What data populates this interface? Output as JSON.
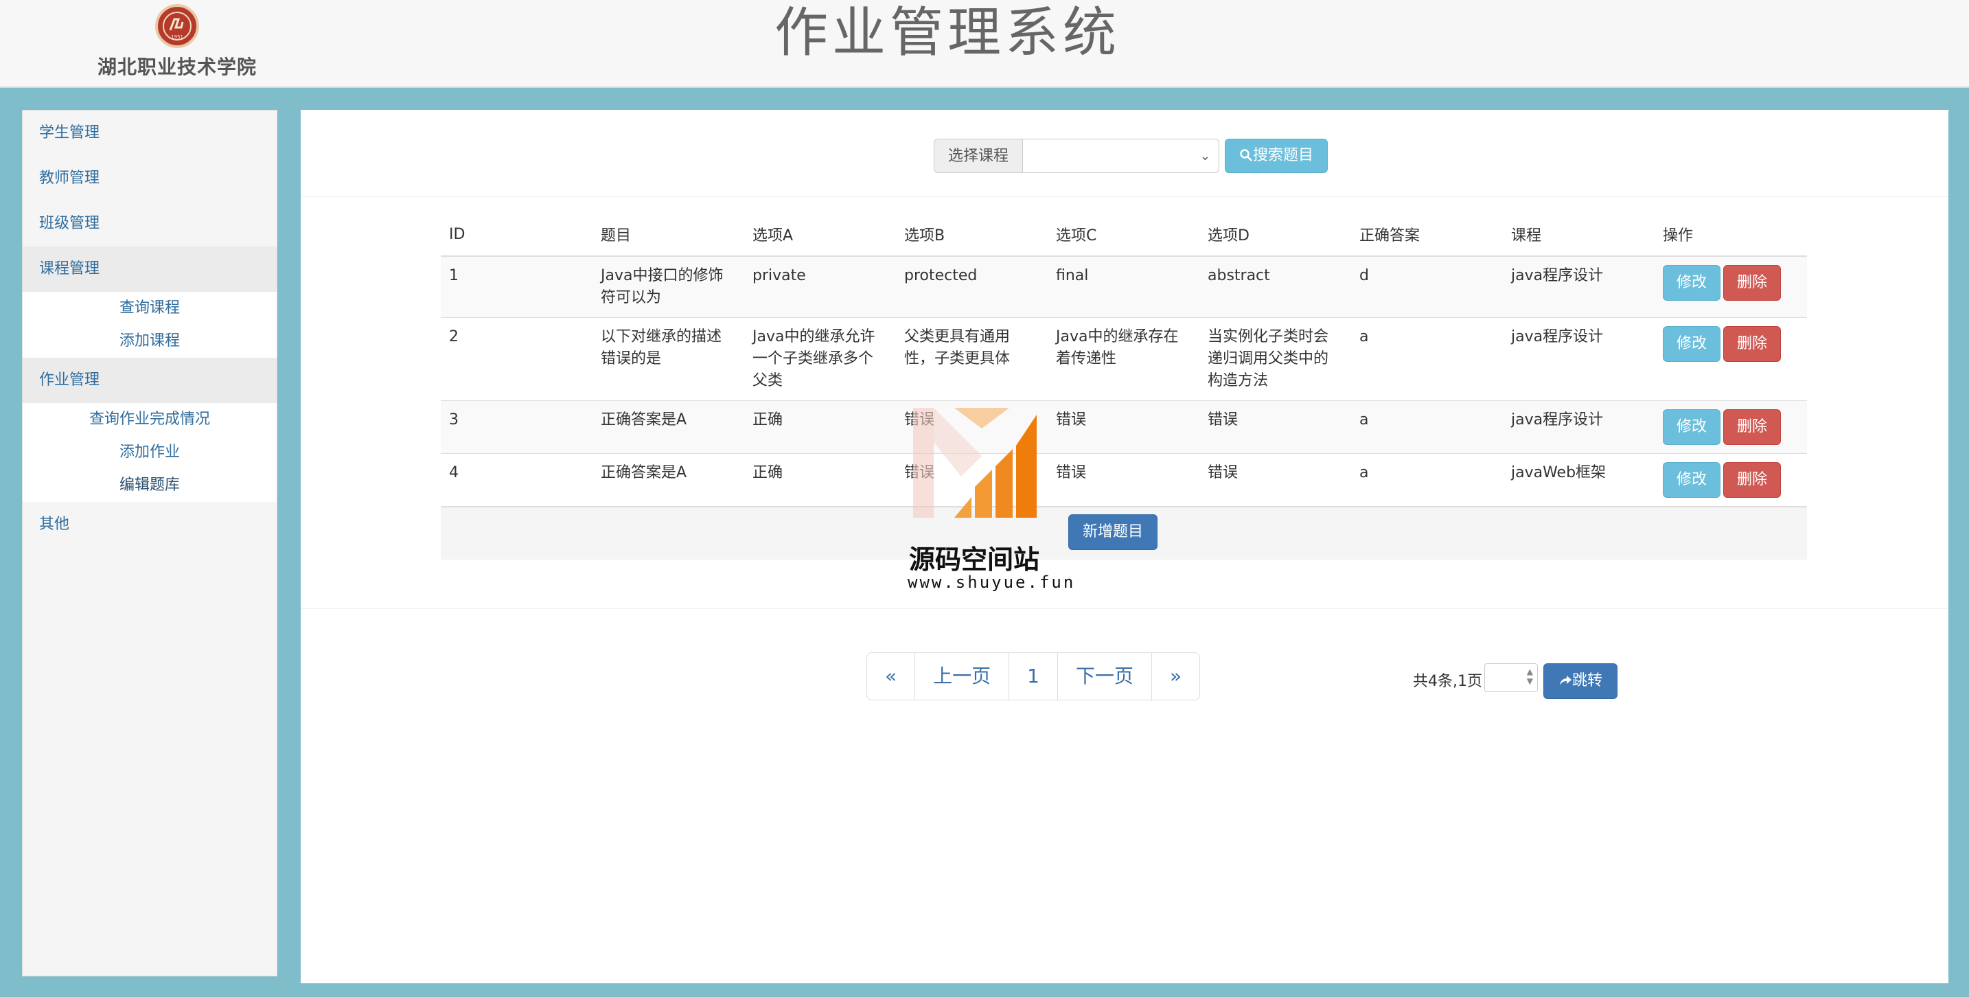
{
  "header": {
    "school_name": "湖北职业技术学院",
    "logo_text": "1951",
    "app_title": "作业管理系统"
  },
  "sidebar": {
    "groups": [
      {
        "label": "学生管理",
        "items": []
      },
      {
        "label": "教师管理",
        "items": []
      },
      {
        "label": "班级管理",
        "items": []
      },
      {
        "label": "课程管理",
        "items": [
          "查询课程",
          "添加课程"
        ]
      },
      {
        "label": "作业管理",
        "items": [
          "查询作业完成情况",
          "添加作业",
          "编辑题库"
        ]
      },
      {
        "label": "其他",
        "items": []
      }
    ]
  },
  "search": {
    "select_label": "选择课程",
    "select_value": "",
    "button_label": "搜索题目"
  },
  "table": {
    "headers": [
      "ID",
      "题目",
      "选项A",
      "选项B",
      "选项C",
      "选项D",
      "正确答案",
      "课程",
      "操作"
    ],
    "rows": [
      [
        "1",
        "Java中接口的修饰符可以为",
        "private",
        "protected",
        "final",
        "abstract",
        "d",
        "java程序设计"
      ],
      [
        "2",
        "以下对继承的描述错误的是",
        "Java中的继承允许一个子类继承多个父类",
        "父类更具有通用性，子类更具体",
        "Java中的继承存在着传递性",
        "当实例化子类时会递归调用父类中的构造方法",
        "a",
        "java程序设计"
      ],
      [
        "3",
        "正确答案是A",
        "正确",
        "错误",
        "错误",
        "错误",
        "a",
        "java程序设计"
      ],
      [
        "4",
        "正确答案是A",
        "正确",
        "错误",
        "错误",
        "错误",
        "a",
        "javaWeb框架"
      ]
    ],
    "edit_label": "修改",
    "delete_label": "删除",
    "add_label": "新增题目"
  },
  "pagination": {
    "first": "«",
    "prev": "上一页",
    "current": "1",
    "next": "下一页",
    "last": "»",
    "info": "共4条,1页",
    "jump_label": "跳转"
  },
  "watermark": {
    "title": "源码空间站",
    "url": "www.shuyue.fun"
  },
  "colors": {
    "background": "#7fbdcb",
    "info": "#6cbfdc",
    "danger": "#d15954",
    "primary": "#3f78b5",
    "link": "#2f6d9e"
  }
}
